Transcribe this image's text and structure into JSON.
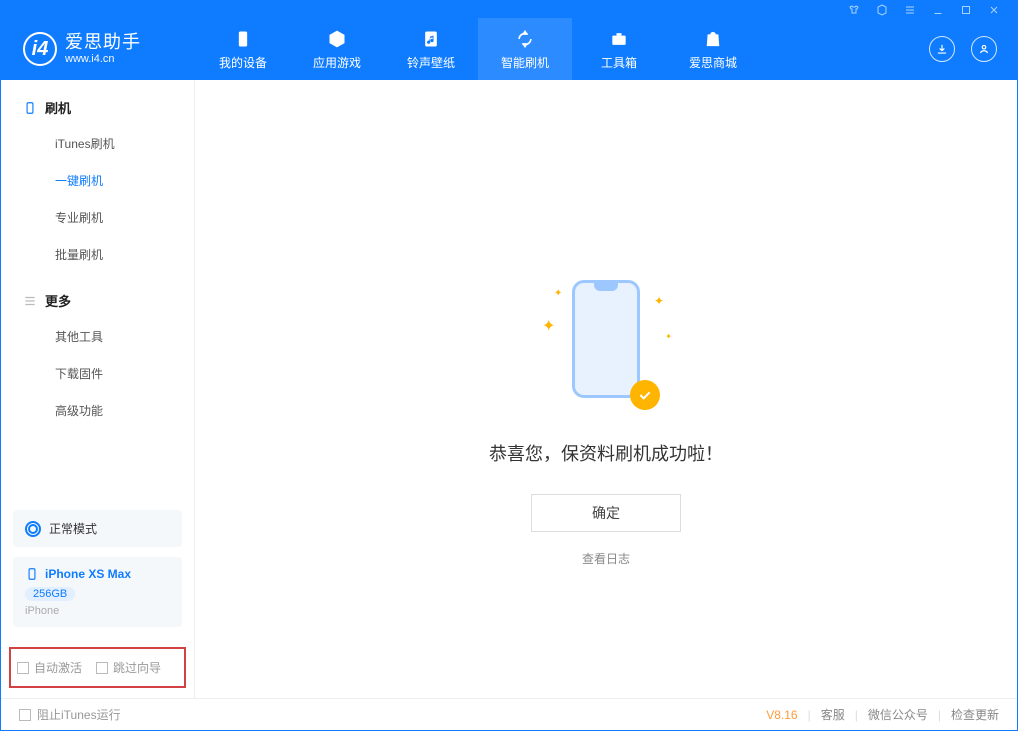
{
  "brand": {
    "title": "爱思助手",
    "subtitle": "www.i4.cn"
  },
  "topTabs": [
    {
      "label": "我的设备"
    },
    {
      "label": "应用游戏"
    },
    {
      "label": "铃声壁纸"
    },
    {
      "label": "智能刷机"
    },
    {
      "label": "工具箱"
    },
    {
      "label": "爱思商城"
    }
  ],
  "sidebar": {
    "group1": {
      "title": "刷机",
      "items": [
        "iTunes刷机",
        "一键刷机",
        "专业刷机",
        "批量刷机"
      ]
    },
    "group2": {
      "title": "更多",
      "items": [
        "其他工具",
        "下载固件",
        "高级功能"
      ]
    },
    "mode": "正常模式",
    "device": {
      "name": "iPhone XS Max",
      "capacity": "256GB",
      "type": "iPhone"
    },
    "opts": {
      "autoActivate": "自动激活",
      "skipGuide": "跳过向导"
    }
  },
  "main": {
    "message": "恭喜您，保资料刷机成功啦！",
    "okLabel": "确定",
    "logLink": "查看日志"
  },
  "status": {
    "blockItunes": "阻止iTunes运行",
    "version": "V8.16",
    "links": [
      "客服",
      "微信公众号",
      "检查更新"
    ]
  }
}
